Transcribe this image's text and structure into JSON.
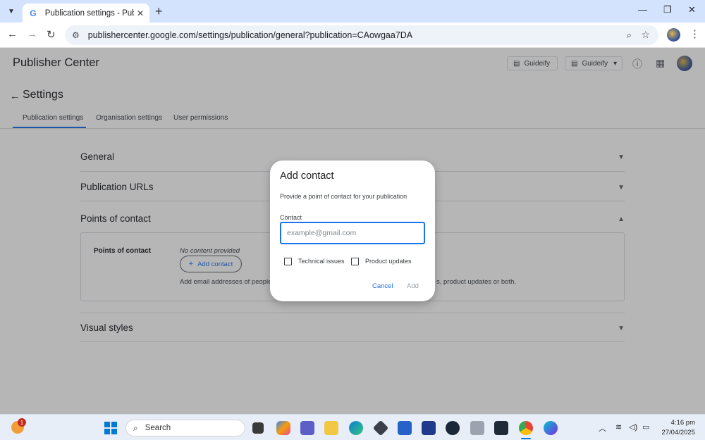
{
  "browser": {
    "tab_title": "Publication settings - Publisher",
    "url": "publishercenter.google.com/settings/publication/general?publication=CAowgaa7DA",
    "new_tab_symbol": "+",
    "close_tab_symbol": "✕"
  },
  "header": {
    "app_title": "Publisher Center",
    "publication_button_1": "Guideify",
    "publication_button_2": "Guideify"
  },
  "settings": {
    "title": "Settings",
    "tabs": [
      {
        "label": "Publication settings",
        "active": true
      },
      {
        "label": "Organisation settings",
        "active": false
      },
      {
        "label": "User permissions",
        "active": false
      }
    ]
  },
  "sections": {
    "general": "General",
    "publication_urls": "Publication URLs",
    "points_of_contact": "Points of contact",
    "visual_styles": "Visual styles"
  },
  "poc_card": {
    "label": "Points of contact",
    "empty_text": "No content provided",
    "add_button": "Add contact",
    "help_text_visible_start": "Add email addresses of people fro",
    "help_text_visible_end": "s, product updates or both."
  },
  "dialog": {
    "title": "Add contact",
    "subtitle": "Provide a point of contact for your publication",
    "contact_label": "Contact",
    "contact_placeholder": "example@gmail.com",
    "contact_value": "",
    "checkbox_technical": "Technical issues",
    "checkbox_product": "Product updates",
    "technical_checked": false,
    "product_checked": false,
    "cancel_label": "Cancel",
    "add_label": "Add"
  },
  "taskbar": {
    "search_label": "Search",
    "notification_count": "1",
    "time": "4:16 pm",
    "date": "27/04/2025"
  },
  "colors": {
    "accent": "#1a73e8",
    "tabbar": "#d3e3fd",
    "scrim": "rgba(32,33,36,0.33)"
  }
}
